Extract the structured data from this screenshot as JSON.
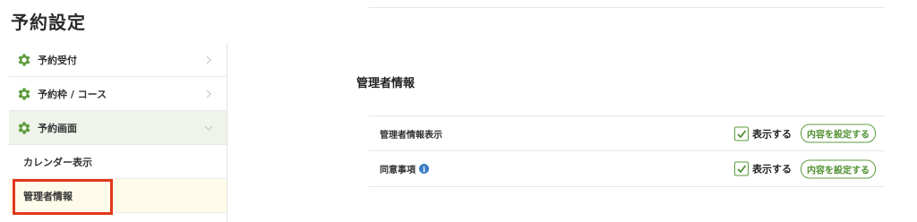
{
  "page": {
    "title": "予約設定"
  },
  "sidebar": {
    "items": [
      {
        "label": "予約受付",
        "icon": "gear-icon"
      },
      {
        "label": "予約枠 / コース",
        "icon": "gear-icon"
      },
      {
        "label": "予約画面",
        "icon": "gear-icon",
        "expanded": true
      }
    ],
    "subitems": [
      {
        "label": "カレンダー表示"
      },
      {
        "label": "管理者情報",
        "selected": true
      }
    ]
  },
  "main": {
    "section_title": "管理者情報",
    "rows": [
      {
        "label": "管理者情報表示",
        "checkbox_label": "表示する",
        "checked": true,
        "button": "内容を設定する"
      },
      {
        "label": "同意事項",
        "info_icon": "i",
        "checkbox_label": "表示する",
        "checked": true,
        "button": "内容を設定する"
      }
    ]
  },
  "colors": {
    "accent_green": "#5d9b3c",
    "highlight_red": "#e0391b",
    "active_bg": "#eef4ea",
    "selected_bg": "#fffbea"
  }
}
